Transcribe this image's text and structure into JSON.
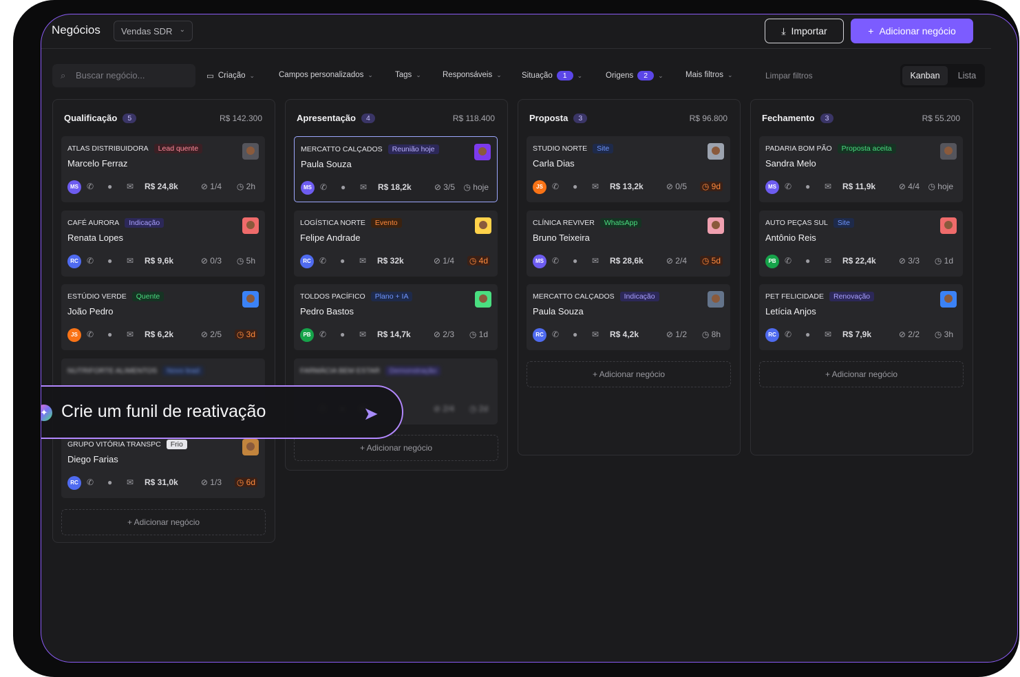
{
  "header": {
    "title": "Negócios",
    "pipeline": "Vendas SDR",
    "import_label": "Importar",
    "add_label": "Adicionar negócio"
  },
  "filters": {
    "search_placeholder": "Buscar negócio...",
    "creation": "Criação",
    "custom_fields": "Campos personalizados",
    "tags": "Tags",
    "owners": "Responsáveis",
    "status": "Situação",
    "status_count": "1",
    "origins": "Origens",
    "origins_count": "2",
    "more": "Mais filtros",
    "clear": "Limpar filtros",
    "view_kanban": "Kanban",
    "view_list": "Lista"
  },
  "add_deal_label": "+ Adicionar negócio",
  "columns": [
    {
      "name": "Qualificação",
      "count": "5",
      "total": "R$ 142.300",
      "cards": [
        {
          "company": "ATLAS DISTRIBUIDORA",
          "tag": "Lead quente",
          "person": "Marcelo Ferraz",
          "initials": "MS",
          "value": "R$ 24,8k",
          "tasks": "1/4",
          "time": "2h"
        },
        {
          "company": "CAFÉ AURORA",
          "tag": "Indicação",
          "person": "Renata Lopes",
          "initials": "RC",
          "value": "R$ 9,6k",
          "tasks": "0/3",
          "time": "5h"
        },
        {
          "company": "ESTÚDIO VERDE",
          "tag": "Quente",
          "person": "João Pedro",
          "initials": "JS",
          "value": "R$ 6,2k",
          "tasks": "2/5",
          "time": "3d"
        },
        {
          "company": "NUTRIFORTE ALIMENTOS",
          "tag": "Novo lead",
          "person": "",
          "initials": "",
          "value": "",
          "tasks": "",
          "time": ""
        },
        {
          "company": "GRUPO VITÓRIA TRANSPC",
          "tag": "Frio",
          "person": "Diego Farias",
          "initials": "RC",
          "value": "R$ 31,0k",
          "tasks": "1/3",
          "time": "6d"
        }
      ]
    },
    {
      "name": "Apresentação",
      "count": "4",
      "total": "R$ 118.400",
      "cards": [
        {
          "company": "MERCATTO CALÇADOS",
          "tag": "Reunião hoje",
          "person": "Paula Souza",
          "initials": "MS",
          "value": "R$ 18,2k",
          "tasks": "3/5",
          "time": "hoje"
        },
        {
          "company": "LOGÍSTICA NORTE",
          "tag": "Evento",
          "person": "Felipe Andrade",
          "initials": "RC",
          "value": "R$ 32k",
          "tasks": "1/4",
          "time": "4d"
        },
        {
          "company": "TOLDOS PACÍFICO",
          "tag": "Plano + IA",
          "person": "Pedro Bastos",
          "initials": "PB",
          "value": "R$ 14,7k",
          "tasks": "2/3",
          "time": "1d"
        },
        {
          "company": "FARMÁCIA BEM ESTAR",
          "tag": "Demonstração",
          "person": "",
          "initials": "",
          "value": "",
          "tasks": "2/4",
          "time": "2d"
        }
      ]
    },
    {
      "name": "Proposta",
      "count": "3",
      "total": "R$ 96.800",
      "cards": [
        {
          "company": "STUDIO NORTE",
          "tag": "Site",
          "person": "Carla Dias",
          "initials": "JS",
          "value": "R$ 13,2k",
          "tasks": "0/5",
          "time": "9d"
        },
        {
          "company": "CLÍNICA REVIVER",
          "tag": "WhatsApp",
          "person": "Bruno Teixeira",
          "initials": "MS",
          "value": "R$ 28,6k",
          "tasks": "2/4",
          "time": "5d"
        },
        {
          "company": "MERCATTO CALÇADOS",
          "tag": "Indicação",
          "person": "Paula Souza",
          "initials": "RC",
          "value": "R$ 4,2k",
          "tasks": "1/2",
          "time": "8h"
        }
      ]
    },
    {
      "name": "Fechamento",
      "count": "3",
      "total": "R$ 55.200",
      "cards": [
        {
          "company": "PADARIA BOM PÃO",
          "tag": "Proposta aceita",
          "person": "Sandra Melo",
          "initials": "MS",
          "value": "R$ 11,9k",
          "tasks": "4/4",
          "time": "hoje"
        },
        {
          "company": "AUTO PEÇAS SUL",
          "tag": "Site",
          "person": "Antônio Reis",
          "initials": "PB",
          "value": "R$ 22,4k",
          "tasks": "3/3",
          "time": "1d"
        },
        {
          "company": "PET FELICIDADE",
          "tag": "Renovação",
          "person": "Letícia Anjos",
          "initials": "RC",
          "value": "R$ 7,9k",
          "tasks": "2/2",
          "time": "3h"
        }
      ]
    }
  ],
  "prompt": {
    "text": "Crie um funil de reativação"
  },
  "colors": {
    "accent": "#7c5cff",
    "alert": "#ff8a3d"
  }
}
